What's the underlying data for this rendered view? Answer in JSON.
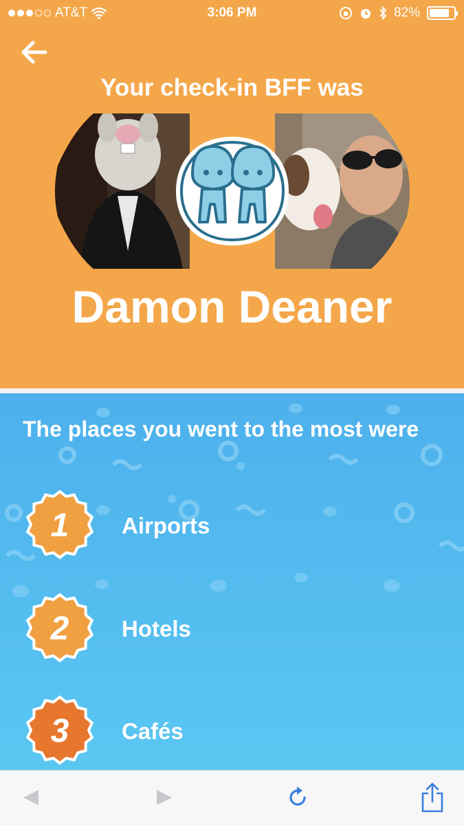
{
  "status_bar": {
    "carrier": "AT&T",
    "time": "3:06 PM",
    "battery": "82%",
    "battery_level": 0.82,
    "signal_bars_filled": 3,
    "signal_bars_total": 5
  },
  "header": {
    "headline": "Your check-in BFF was",
    "friend_name": "Damon Deaner",
    "background_color": "#f4a74a"
  },
  "places": {
    "title": "The places you went to the most were",
    "items": [
      {
        "rank": "1",
        "label": "Airports"
      },
      {
        "rank": "2",
        "label": "Hotels"
      },
      {
        "rank": "3",
        "label": "Cafés"
      }
    ],
    "badge_color": "#f0a040",
    "badge_color_third": "#e8772e"
  },
  "toolbar": {
    "icons": [
      "back-arrow-icon",
      "forward-arrow-icon",
      "reload-icon",
      "share-icon"
    ],
    "accent_color": "#3a7ee0"
  }
}
